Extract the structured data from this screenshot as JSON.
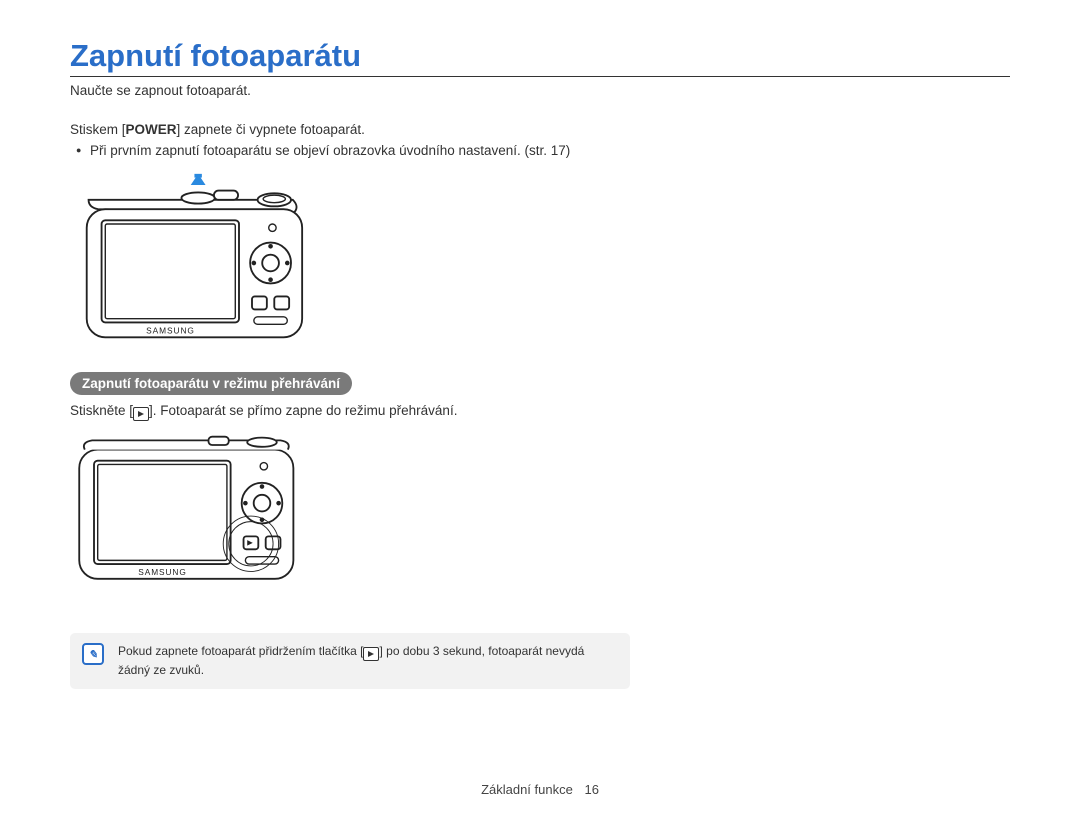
{
  "page": {
    "title": "Zapnutí fotoaparátu",
    "subtitle": "Naučte se zapnout fotoaparát.",
    "instruction_prefix": "Stiskem [",
    "instruction_bold": "POWER",
    "instruction_suffix": "] zapnete či vypnete fotoaparát.",
    "bullet1": "Při prvním zapnutí fotoaparátu se objeví obrazovka úvodního nastavení. (str. 17)",
    "playback_heading": "Zapnutí fotoaparátu v režimu přehrávání",
    "playback_text_prefix": "Stiskněte [",
    "playback_text_suffix": "]. Fotoaparát se přímo zapne do režimu přehrávání.",
    "note_prefix": "Pokud zapnete fotoaparát přidržením tlačítka [",
    "note_suffix": "] po dobu 3 sekund, fotoaparát nevydá žádný ze zvuků.",
    "footer_section": "Základní funkce",
    "footer_page": "16",
    "icons": {
      "note_glyph": "✎",
      "play_icon_name": "play-icon"
    }
  }
}
